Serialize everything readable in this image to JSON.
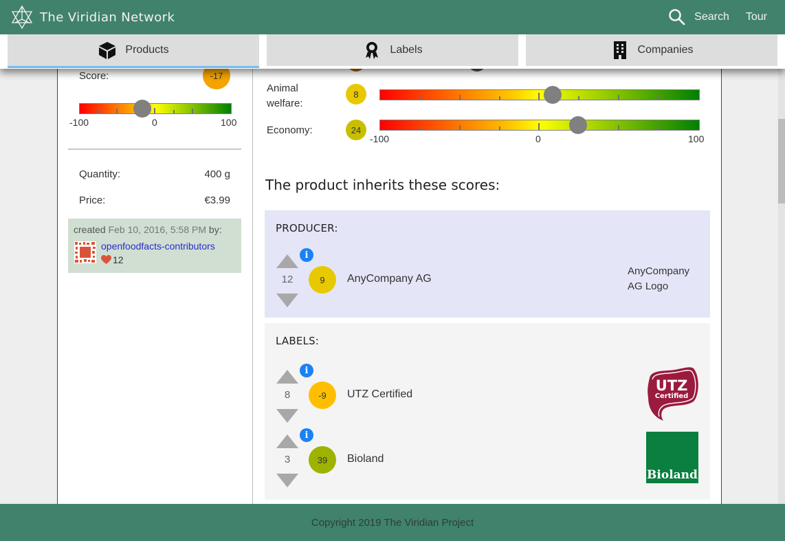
{
  "header": {
    "title": "The Viridian Network",
    "search_label": "Search",
    "tour_label": "Tour"
  },
  "tabs": [
    {
      "label": "Products",
      "icon": "cube-icon",
      "active": true
    },
    {
      "label": "Labels",
      "icon": "award-ribbon-icon",
      "active": false
    },
    {
      "label": "Companies",
      "icon": "building-icon",
      "active": false
    }
  ],
  "left": {
    "score_label": "Score:",
    "score_value": "-17",
    "score_fraction": -0.17,
    "scale_min": "-100",
    "scale_mid": "0",
    "scale_max": "100",
    "quantity_label": "Quantity:",
    "quantity_value": "400 g",
    "price_label": "Price:",
    "price_value": "€3.99",
    "created_prefix": "created",
    "created_date": "Feb 10, 2016, 5:58 PM",
    "created_suffix": "by:",
    "created_by": "openfoodfacts-contributors",
    "likes": "12"
  },
  "scores": {
    "animal_label_line1": "Animal",
    "animal_label_line2": "welfare:",
    "animal_value": "8",
    "animal_color": "#e8c900",
    "economy_label": "Economy:",
    "economy_value": "24",
    "economy_color": "#c8bf00",
    "scale_min": "-100",
    "scale_mid": "0",
    "scale_max": "100"
  },
  "inherit": {
    "title": "The product inherits these scores:",
    "producer": {
      "heading": "PRODUCER:",
      "items": [
        {
          "votes": "12",
          "score": "9",
          "color": "#e8c900",
          "name": "AnyCompany AG",
          "logo_alt": "AnyCompany AG Logo"
        }
      ]
    },
    "labels": {
      "heading": "LABELS:",
      "items": [
        {
          "votes": "8",
          "score": "-9",
          "color": "#ffbf00",
          "name": "UTZ Certified",
          "logo": "UTZ Certified"
        },
        {
          "votes": "3",
          "score": "39",
          "color": "#9db300",
          "name": "Bioland",
          "logo": "Bioland"
        }
      ]
    }
  },
  "colors": {
    "brand": "#41826d",
    "tab_active_underline": "#73bcf0",
    "info": "#1a82f5"
  },
  "footer": {
    "copyright": "Copyright 2019 The Viridian Project"
  }
}
